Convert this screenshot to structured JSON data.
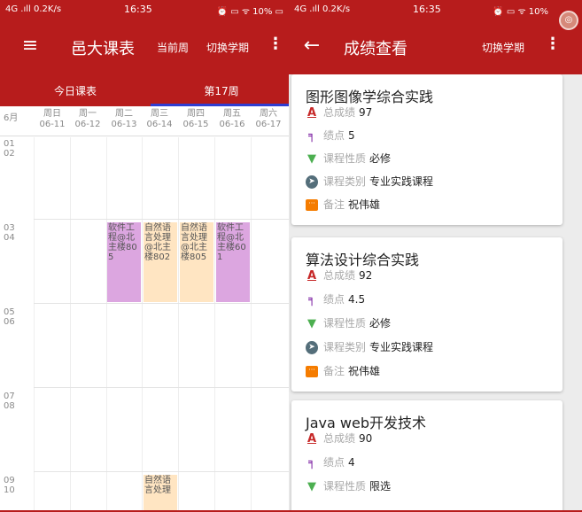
{
  "left": {
    "status": {
      "network": "4G .ıll 0.2K/s",
      "time": "16:35",
      "system": "⏰ ▭ ᯤ 10% ▭"
    },
    "appbar": {
      "title": "邑大课表",
      "current_week": "当前周",
      "switch_term": "切换学期"
    },
    "tabs": {
      "today": "今日课表",
      "week": "第17周"
    },
    "month": "6月",
    "days": [
      {
        "name": "周日",
        "date": "06-11"
      },
      {
        "name": "周一",
        "date": "06-12"
      },
      {
        "name": "周二",
        "date": "06-13"
      },
      {
        "name": "周三",
        "date": "06-14"
      },
      {
        "name": "周四",
        "date": "06-15"
      },
      {
        "name": "周五",
        "date": "06-16"
      },
      {
        "name": "周六",
        "date": "06-17"
      }
    ],
    "slots": [
      {
        "a": "01",
        "b": "02"
      },
      {
        "a": "03",
        "b": "04"
      },
      {
        "a": "05",
        "b": "06"
      },
      {
        "a": "07",
        "b": "08"
      },
      {
        "a": "09",
        "b": "10"
      }
    ],
    "courses": [
      {
        "text": "软件工程@北主楼805",
        "day": "周二",
        "slot": "03",
        "color": "#dca6e0"
      },
      {
        "text": "自然语言处理@北主楼802",
        "day": "周三",
        "slot": "03",
        "color": "#ffe5c2"
      },
      {
        "text": "自然语言处理@北主楼805",
        "day": "周四",
        "slot": "03",
        "color": "#ffe5c2"
      },
      {
        "text": "软件工程@北主楼601",
        "day": "周五",
        "slot": "03",
        "color": "#dca6e0"
      },
      {
        "text": "自然语言处理",
        "day": "周三",
        "slot": "09",
        "color": "#ffe5c2"
      }
    ]
  },
  "right": {
    "status": {
      "network": "4G .ıll 0.2K/s",
      "time": "16:35",
      "system": "⏰ ▭ ᯤ 10%"
    },
    "appbar": {
      "title": "成绩查看",
      "switch_term": "切换学期"
    },
    "labels": {
      "total": "总成绩",
      "gpa": "绩点",
      "nature": "课程性质",
      "category": "课程类别",
      "note": "备注"
    },
    "cards": [
      {
        "name": "图形图像学综合实践",
        "total": "97",
        "gpa": "5",
        "nature": "必修",
        "category": "专业实践课程",
        "note": "祝伟雄"
      },
      {
        "name": "算法设计综合实践",
        "total": "92",
        "gpa": "4.5",
        "nature": "必修",
        "category": "专业实践课程",
        "note": "祝伟雄"
      },
      {
        "name": "Java web开发技术",
        "total": "90",
        "gpa": "4",
        "nature": "限选"
      }
    ]
  }
}
